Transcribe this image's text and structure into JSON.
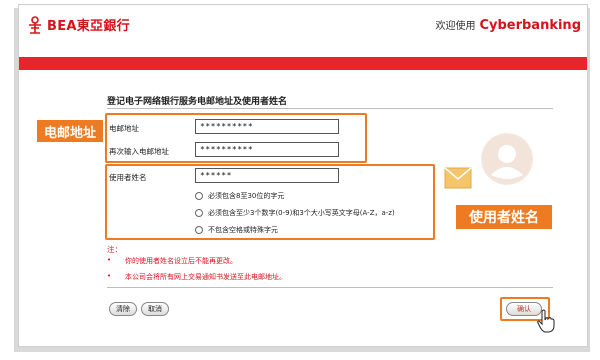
{
  "header": {
    "logo_text": "BEA東亞銀行",
    "welcome_text": "欢迎使用",
    "brand_text": "Cyberbanking",
    "accent_color": "#d8121b"
  },
  "page": {
    "title": "登记电子网络银行服务电邮地址及使用者姓名"
  },
  "email_section": {
    "tag_label": "电邮地址",
    "email_label": "电邮地址",
    "email_value": "**********",
    "confirm_label": "再次输入电邮地址",
    "confirm_value": "**********"
  },
  "username_section": {
    "tag_label": "使用者姓名",
    "username_label": "使用者姓名",
    "username_value": "******",
    "rules": [
      "必须包含8至30位的字元",
      "必须包含至少3个数字(0-9)和3个大小写英文字母(A-Z，a-z)",
      "不包含空格或特殊字元"
    ]
  },
  "notes": {
    "heading": "注：",
    "items": [
      "你的使用者姓名设立后不能再更改。",
      "本公司会将所有网上交易通知书发送至此电邮地址。"
    ]
  },
  "buttons": {
    "clear": "清除",
    "cancel": "取消",
    "confirm": "确认"
  },
  "highlight_color": "#ee7a22"
}
